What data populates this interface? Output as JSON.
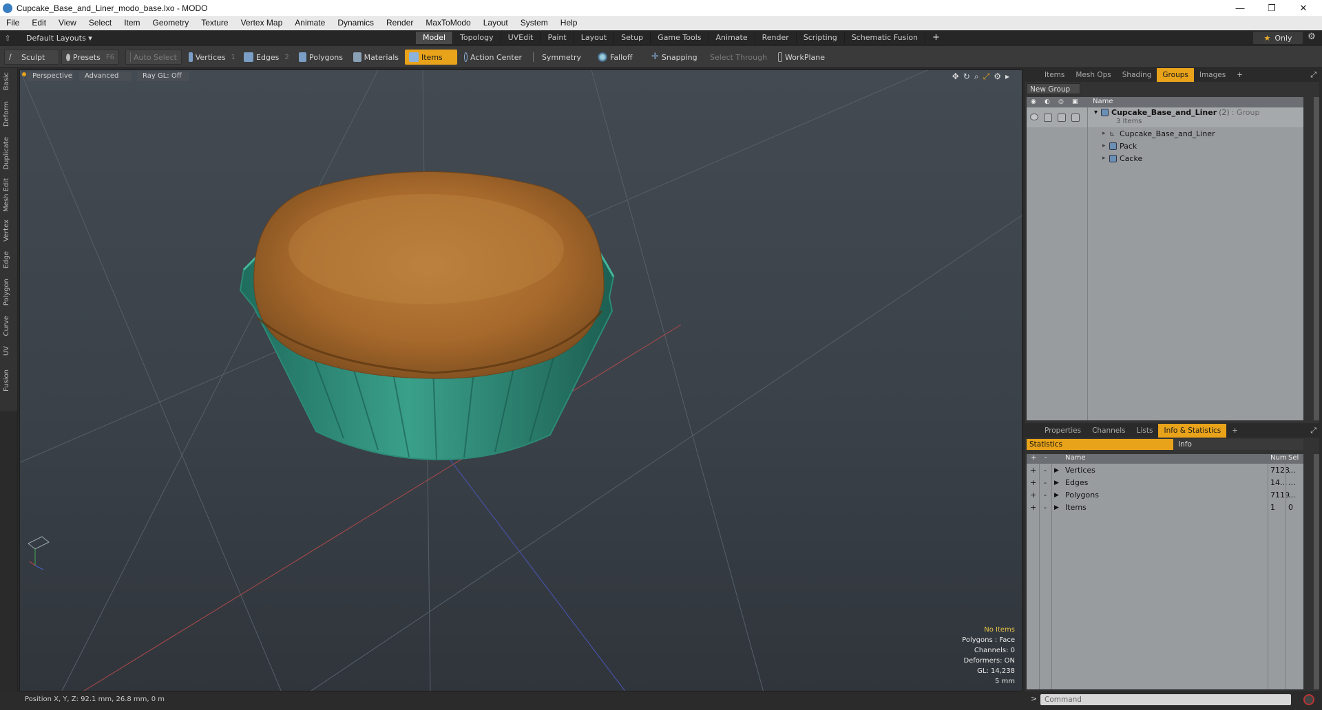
{
  "window": {
    "title": "Cupcake_Base_and_Liner_modo_base.lxo - MODO",
    "minimize": "—",
    "maximize": "❐",
    "close": "✕"
  },
  "menu": [
    "File",
    "Edit",
    "View",
    "Select",
    "Item",
    "Geometry",
    "Texture",
    "Vertex Map",
    "Animate",
    "Dynamics",
    "Render",
    "MaxToModo",
    "Layout",
    "System",
    "Help"
  ],
  "layouts": {
    "label": "Default Layouts ▾"
  },
  "layout_tabs": [
    {
      "label": "Model",
      "active": true
    },
    {
      "label": "Topology"
    },
    {
      "label": "UVEdit"
    },
    {
      "label": "Paint"
    },
    {
      "label": "Layout"
    },
    {
      "label": "Setup"
    },
    {
      "label": "Game Tools"
    },
    {
      "label": "Animate"
    },
    {
      "label": "Render"
    },
    {
      "label": "Scripting"
    },
    {
      "label": "Schematic Fusion"
    }
  ],
  "add_tab": "+",
  "only_label": "Only",
  "toolbar": {
    "sculpt": "Sculpt",
    "presets": "Presets",
    "presets_key": "F6",
    "auto_select": "Auto Select",
    "vertices": "Vertices",
    "vertices_key": "1",
    "edges": "Edges",
    "edges_key": "2",
    "polygons": "Polygons",
    "materials": "Materials",
    "items": "Items",
    "action_center": "Action Center",
    "symmetry": "Symmetry",
    "falloff": "Falloff",
    "snapping": "Snapping",
    "select_through": "Select Through",
    "workplane": "WorkPlane"
  },
  "left_tabs": [
    "Basic",
    "Deform",
    "Duplicate",
    "Mesh Edit",
    "Vertex",
    "Edge",
    "Polygon",
    "Curve",
    "UV",
    "Fusion"
  ],
  "viewport": {
    "view": "Perspective",
    "mode": "Advanced",
    "raygl": "Ray GL: Off",
    "hud": {
      "items": "No Items",
      "polygons": "Polygons : Face",
      "channels": "Channels: 0",
      "deformers": "Deformers: ON",
      "gl": "GL: 14,238",
      "scale": "5 mm"
    }
  },
  "status": {
    "position": "Position X, Y, Z:  92.1 mm, 26.8 mm, 0 m"
  },
  "upper_panel": {
    "tabs": [
      {
        "label": "Items"
      },
      {
        "label": "Mesh Ops"
      },
      {
        "label": "Shading"
      },
      {
        "label": "Groups",
        "active": true
      },
      {
        "label": "Images"
      }
    ],
    "new_group": "New Group",
    "header_name": "Name",
    "group_name": "Cupcake_Base_and_Liner",
    "group_count": "(2)",
    "group_type": ": Group",
    "group_sub": "3 Items",
    "children": [
      "Cupcake_Base_and_Liner",
      "Pack",
      "Cacke"
    ]
  },
  "lower_panel": {
    "tabs": [
      {
        "label": "Properties"
      },
      {
        "label": "Channels"
      },
      {
        "label": "Lists"
      },
      {
        "label": "Info & Statistics",
        "active": true
      }
    ],
    "subtabs": {
      "statistics": "Statistics",
      "info": "Info"
    },
    "headers": {
      "name": "Name",
      "num": "Num",
      "sel": "Sel"
    },
    "rows": [
      {
        "name": "Vertices",
        "num": "7123",
        "sel": "..."
      },
      {
        "name": "Edges",
        "num": "14...",
        "sel": "..."
      },
      {
        "name": "Polygons",
        "num": "7119",
        "sel": "..."
      },
      {
        "name": "Items",
        "num": "1",
        "sel": "0"
      }
    ]
  },
  "command": {
    "prompt": ">",
    "placeholder": "Command"
  },
  "colors": {
    "accent": "#e8a31a",
    "viewport_top": "#434a52",
    "panel": "#999c9f",
    "liner": "#2f8f7a",
    "muffin": "#b8792e"
  }
}
